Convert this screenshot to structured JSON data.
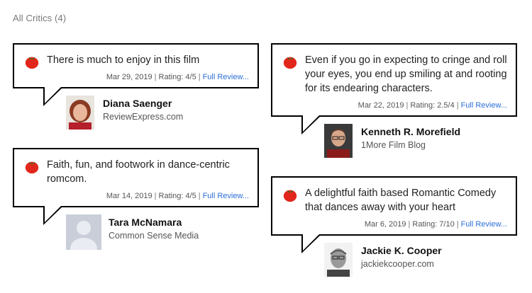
{
  "header": {
    "title": "All Critics (4)"
  },
  "reviews": [
    {
      "quote": "There is much to enjoy in this film",
      "date": "Mar 29, 2019",
      "rating": "Rating: 4/5",
      "link": "Full Review...",
      "critic": "Diana Saenger",
      "publication": "ReviewExpress.com"
    },
    {
      "quote": "Even if you go in expecting to cringe and roll your eyes, you end up smiling at and rooting for its endearing characters.",
      "date": "Mar 22, 2019",
      "rating": "Rating: 2.5/4",
      "link": "Full Review...",
      "critic": "Kenneth R. Morefield",
      "publication": "1More Film Blog"
    },
    {
      "quote": "Faith, fun, and footwork in dance-centric romcom.",
      "date": "Mar 14, 2019",
      "rating": "Rating: 4/5",
      "link": "Full Review...",
      "critic": "Tara McNamara",
      "publication": "Common Sense Media"
    },
    {
      "quote": "A delightful faith based Romantic Comedy that dances away with your heart",
      "date": "Mar 6, 2019",
      "rating": "Rating: 7/10",
      "link": "Full Review...",
      "critic": "Jackie K. Cooper",
      "publication": "jackiekcooper.com"
    }
  ],
  "separator": "|",
  "icons": {
    "rating_icon": "fresh-tomato-icon",
    "tomato_color": "#e2261b",
    "link_color": "#2b6ed8"
  }
}
